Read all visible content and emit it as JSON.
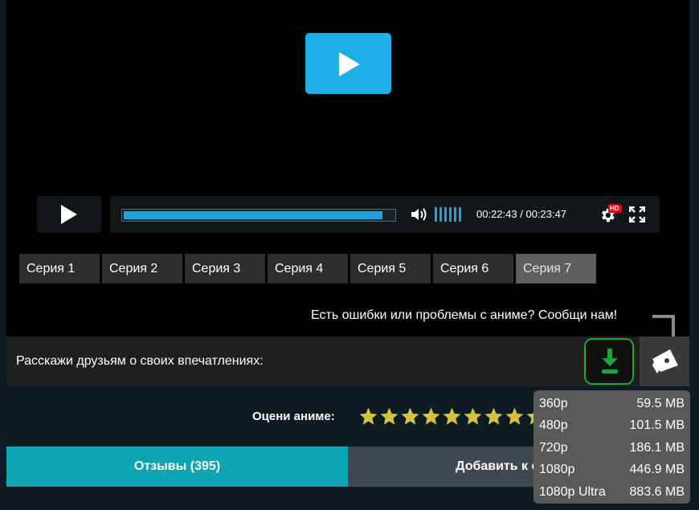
{
  "player": {
    "progress": 0.952,
    "volume_bars": 6,
    "time_current": "00:22:43",
    "time_separator": "/",
    "time_total": "00:23:47",
    "hd_badge": "HD",
    "accent_color": "#1eaee8"
  },
  "episodes": [
    {
      "label": "Серия 1"
    },
    {
      "label": "Серия 2"
    },
    {
      "label": "Серия 3"
    },
    {
      "label": "Серия 4"
    },
    {
      "label": "Серия 5"
    },
    {
      "label": "Серия 6"
    },
    {
      "label": "Серия 7",
      "active": true
    }
  ],
  "report_text": "Есть ошибки или проблемы с аниме? Сообщи нам!",
  "share": {
    "label": "Расскажи друзьям о своих впечатлениях:",
    "download_icon": "download-icon",
    "horn_icon": "megaphone-icon"
  },
  "rating": {
    "label": "Оцени аниме:",
    "stars_total": 10,
    "star_color": "#d4c23a"
  },
  "buttons": {
    "reviews": "Отзывы (395)",
    "add": "Добавить к себе"
  },
  "quality_menu": [
    {
      "quality": "360p",
      "size": "59.5 MB"
    },
    {
      "quality": "480p",
      "size": "101.5 MB"
    },
    {
      "quality": "720p",
      "size": "186.1 MB"
    },
    {
      "quality": "1080p",
      "size": "446.9 MB"
    },
    {
      "quality": "1080p Ultra",
      "size": "883.6 MB"
    }
  ]
}
